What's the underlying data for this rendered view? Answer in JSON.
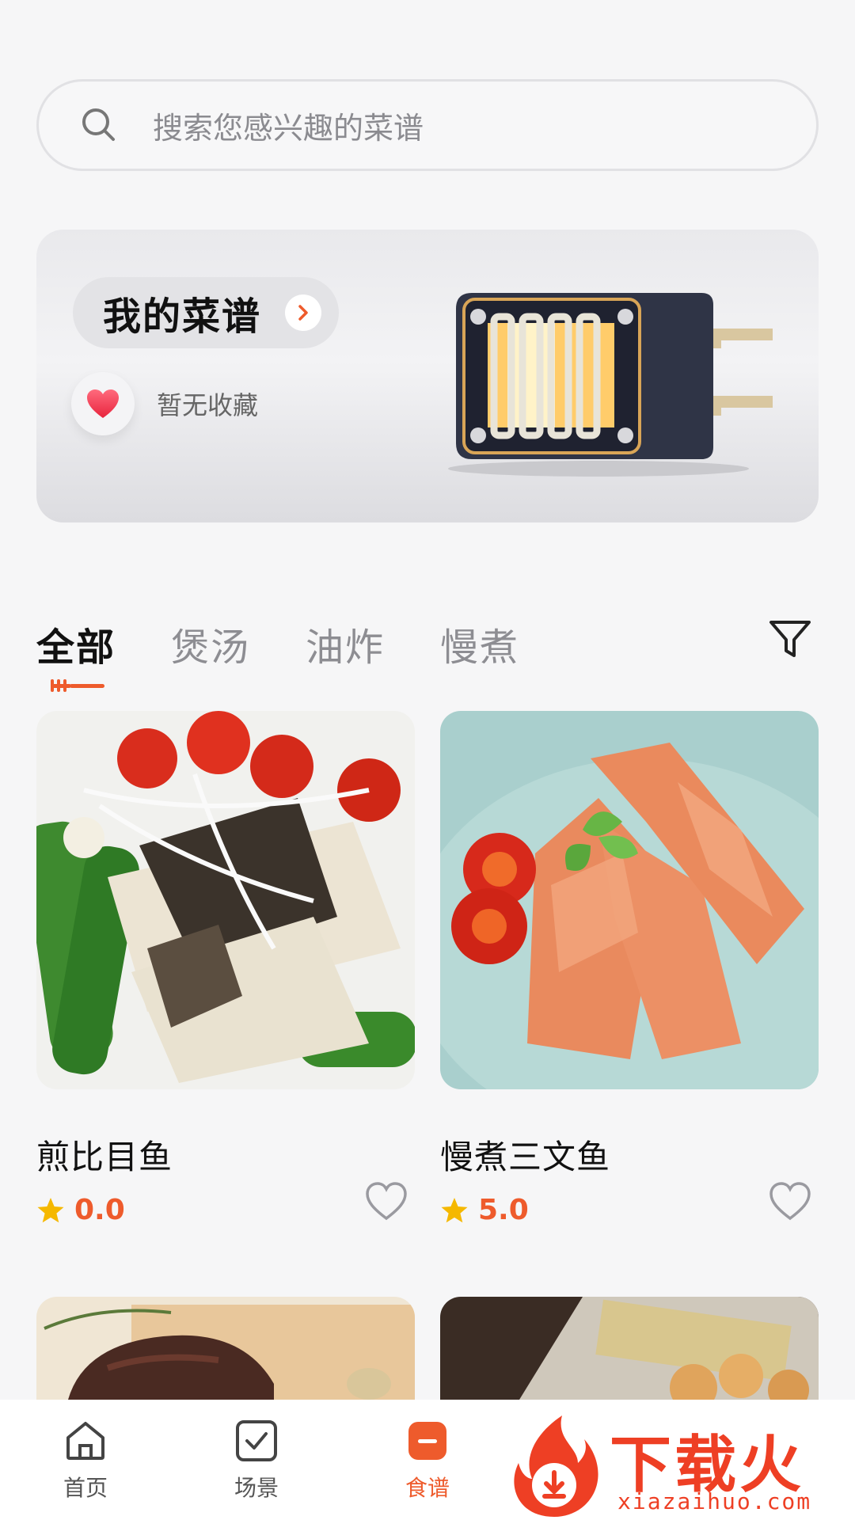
{
  "search": {
    "placeholder": "搜索您感兴趣的菜谱"
  },
  "banner": {
    "title": "我的菜谱",
    "favorites_text": "暂无收藏"
  },
  "tabs": [
    {
      "label": "全部",
      "active": true
    },
    {
      "label": "煲汤",
      "active": false
    },
    {
      "label": "油炸",
      "active": false
    },
    {
      "label": "慢煮",
      "active": false
    }
  ],
  "recipes": [
    {
      "name": "煎比目鱼",
      "rating": "0.0"
    },
    {
      "name": "慢煮三文鱼",
      "rating": "5.0"
    }
  ],
  "nav": [
    {
      "label": "首页",
      "icon": "home-icon",
      "active": false
    },
    {
      "label": "场景",
      "icon": "checkbox-icon",
      "active": false
    },
    {
      "label": "食谱",
      "icon": "recipe-icon",
      "active": true
    }
  ],
  "watermark": {
    "brand": "下载火",
    "url": "xiazaihuo.com"
  },
  "colors": {
    "accent": "#ee5b2c",
    "star": "#f5b800",
    "background": "#f6f6f7"
  }
}
